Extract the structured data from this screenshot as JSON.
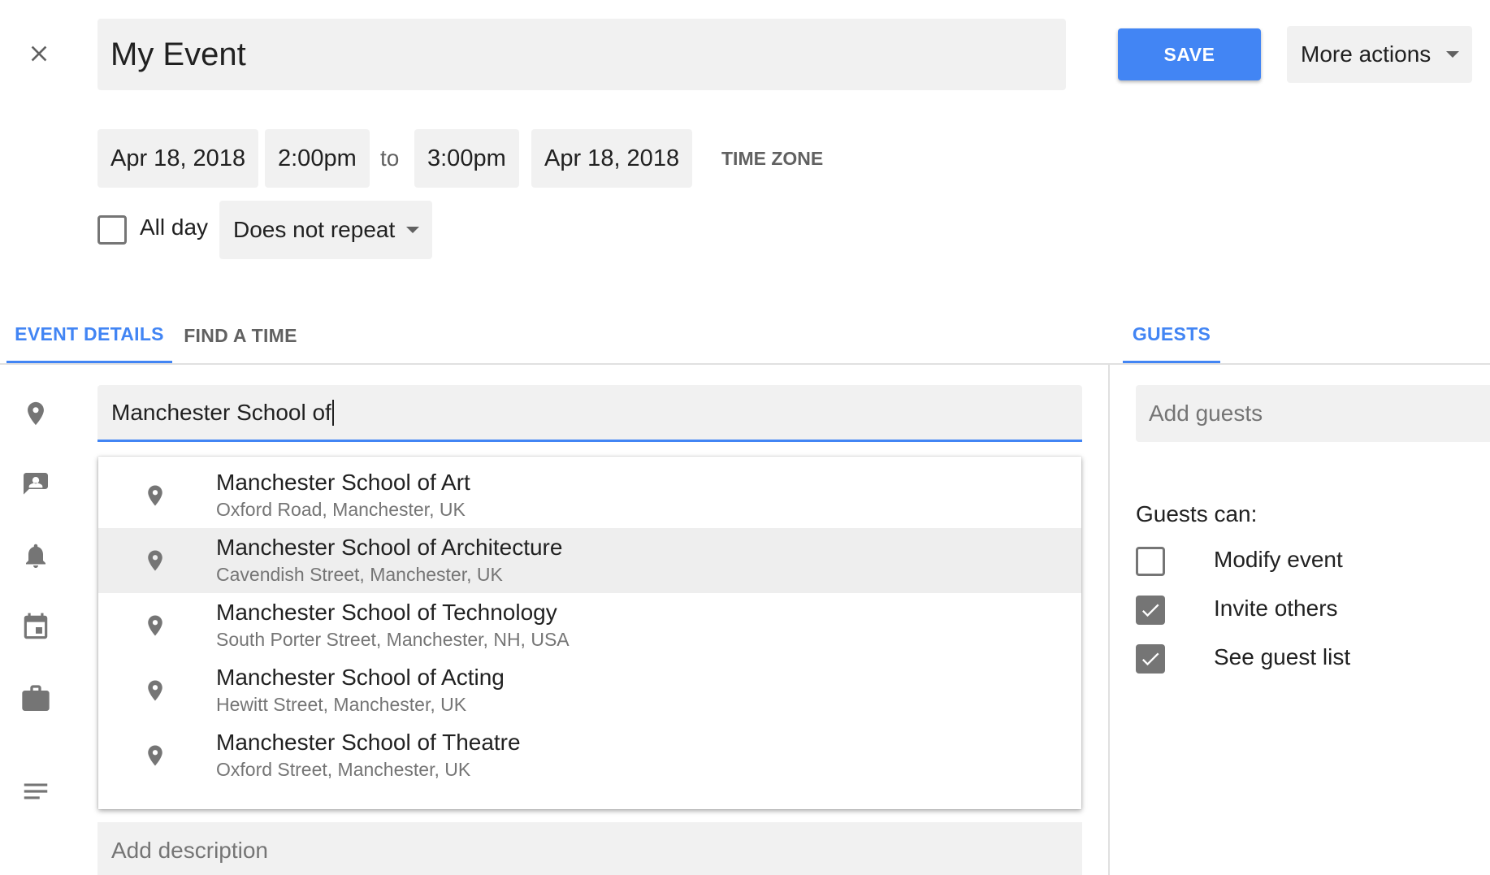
{
  "header": {
    "title": "My Event",
    "save_label": "SAVE",
    "more_actions_label": "More actions"
  },
  "datetime": {
    "start_date": "Apr 18, 2018",
    "start_time": "2:00pm",
    "to_label": "to",
    "end_time": "3:00pm",
    "end_date": "Apr 18, 2018",
    "timezone_label": "TIME ZONE"
  },
  "options": {
    "all_day_label": "All day",
    "all_day_checked": false,
    "repeat_value": "Does not repeat"
  },
  "tabs": {
    "event_details": "EVENT DETAILS",
    "find_a_time": "FIND A TIME",
    "guests": "GUESTS"
  },
  "location": {
    "value": "Manchester School of"
  },
  "suggestions": [
    {
      "name": "Manchester School of Art",
      "address": "Oxford Road, Manchester, UK"
    },
    {
      "name": "Manchester School of Architecture",
      "address": "Cavendish Street, Manchester, UK"
    },
    {
      "name": "Manchester School of Technology",
      "address": "South Porter Street, Manchester, NH, USA"
    },
    {
      "name": "Manchester School of Acting",
      "address": "Hewitt Street, Manchester, UK"
    },
    {
      "name": "Manchester School of Theatre",
      "address": "Oxford Street, Manchester, UK"
    }
  ],
  "description": {
    "placeholder": "Add description"
  },
  "guests": {
    "placeholder": "Add guests",
    "permissions_title": "Guests can:",
    "permissions": [
      {
        "label": "Modify event",
        "checked": false
      },
      {
        "label": "Invite others",
        "checked": true
      },
      {
        "label": "See guest list",
        "checked": true
      }
    ]
  },
  "colors": {
    "accent": "#4285f4",
    "field_bg": "#f1f1f1",
    "icon": "#757575",
    "highlight_row": "#eeeeee"
  },
  "icons": {
    "close": "close-icon",
    "location": "location-pin-icon",
    "contact": "contact-card-icon",
    "notification": "bell-icon",
    "calendar": "calendar-icon",
    "busy": "briefcase-icon",
    "description": "notes-icon"
  }
}
